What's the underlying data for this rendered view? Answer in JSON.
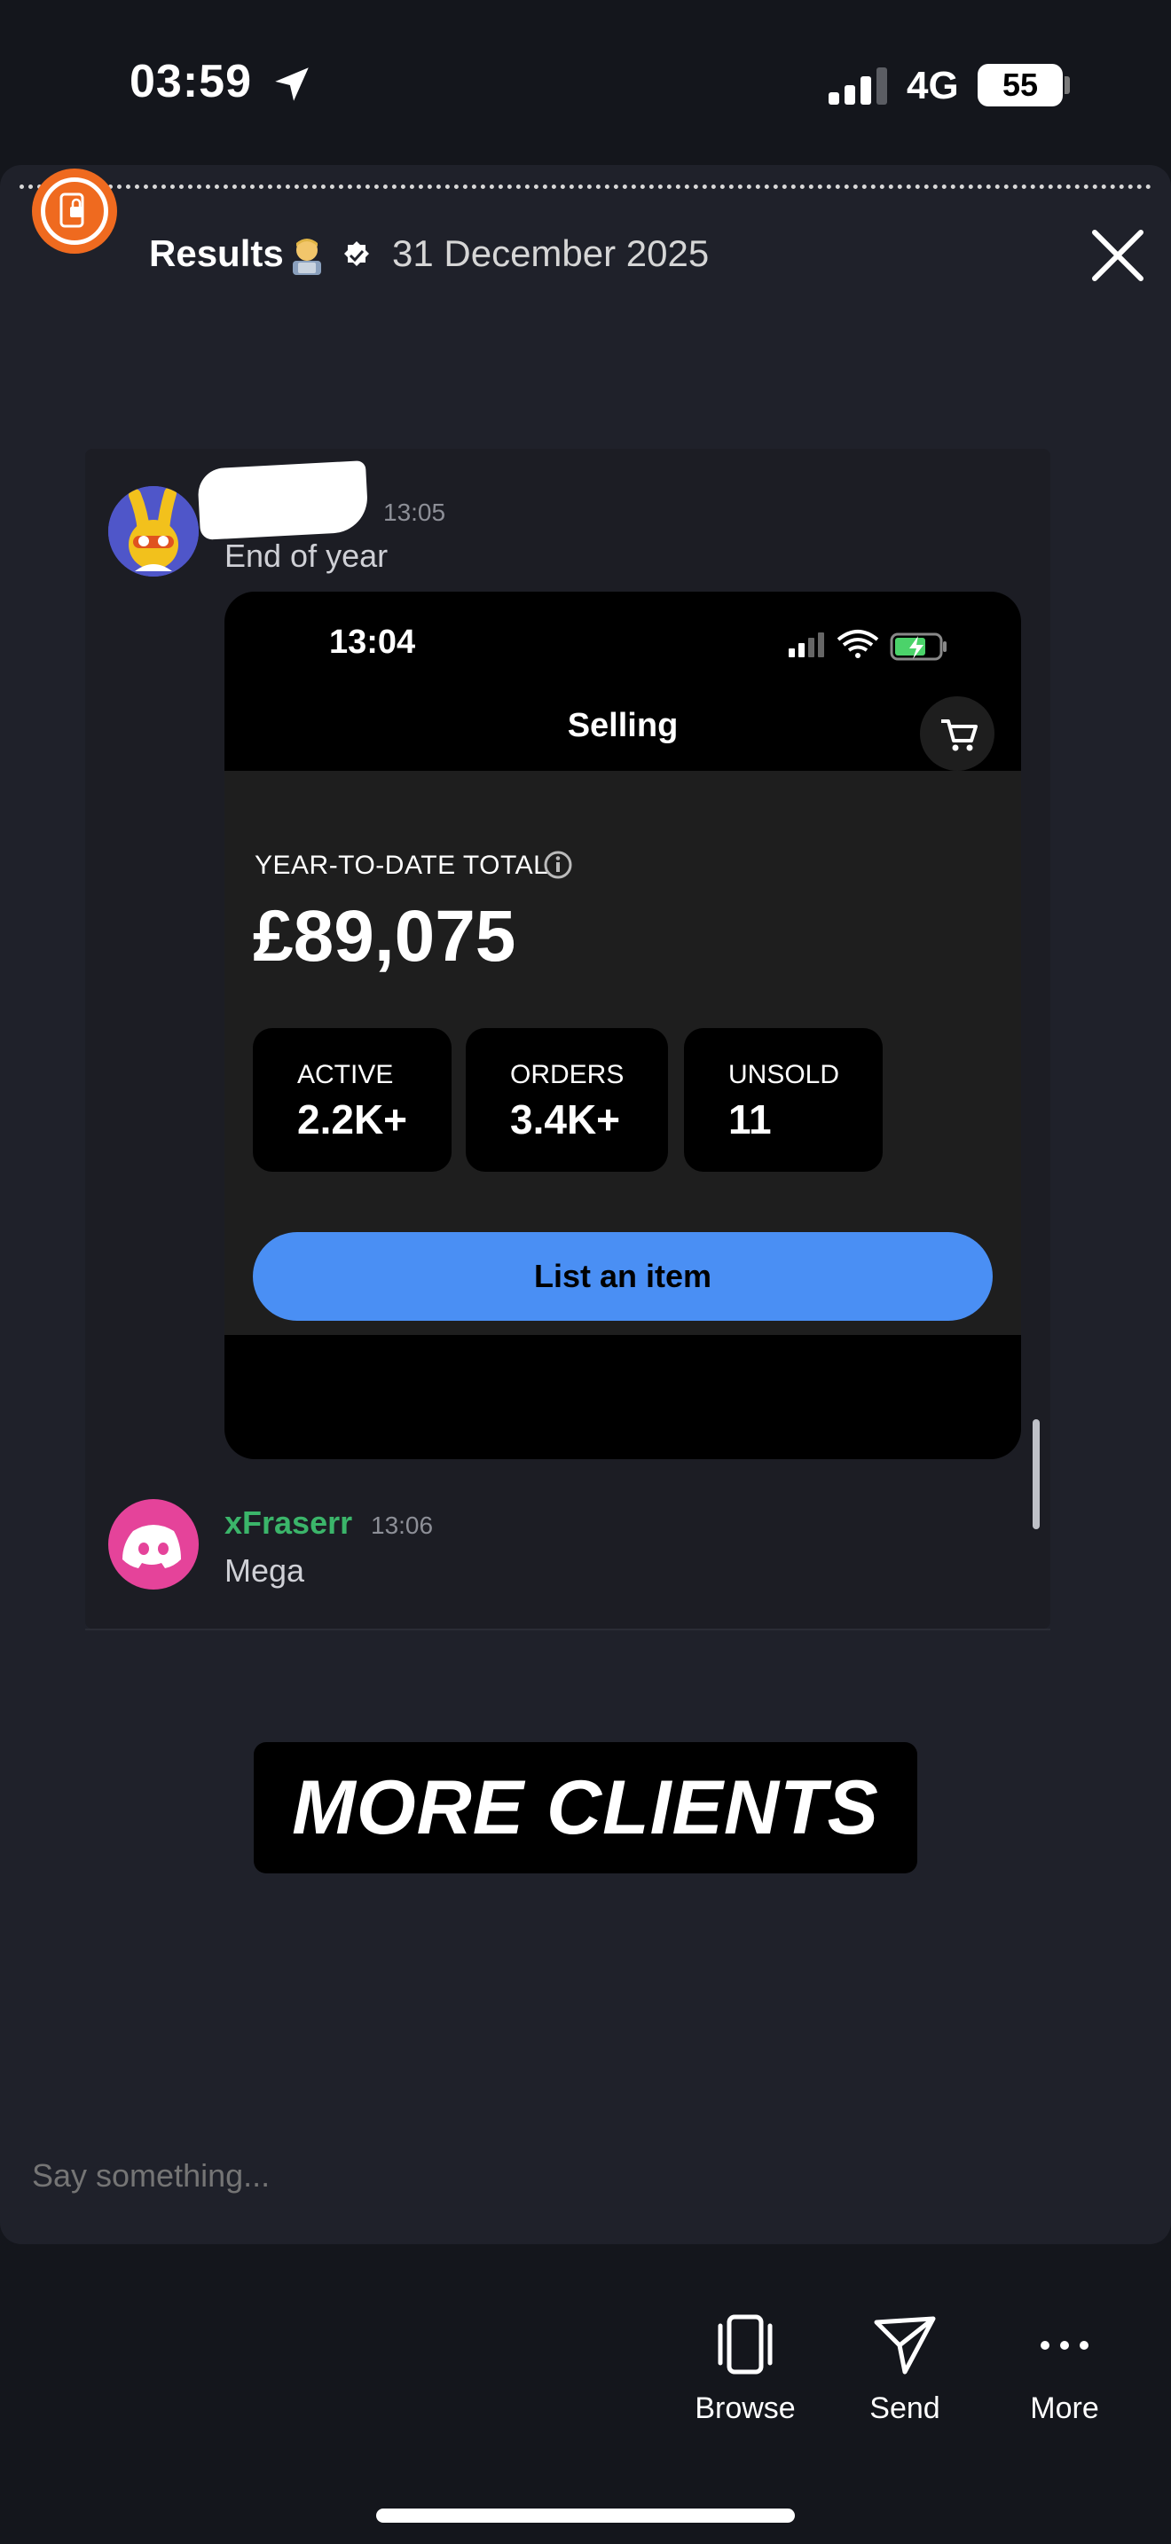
{
  "status_bar": {
    "time": "03:59",
    "network": "4G",
    "battery": "55"
  },
  "story": {
    "title": "Results",
    "date": "31 December 2025"
  },
  "messages": [
    {
      "time": "13:05",
      "text": "End of year"
    },
    {
      "author": "xFraserr",
      "time": "13:06",
      "text": "Mega"
    }
  ],
  "embedded_screenshot": {
    "time": "13:04",
    "title": "Selling",
    "ytd_label": "YEAR-TO-DATE TOTAL",
    "ytd_value": "£89,075",
    "stats": [
      {
        "label": "ACTIVE",
        "value": "2.2K+"
      },
      {
        "label": "ORDERS",
        "value": "3.4K+"
      },
      {
        "label": "UNSOLD",
        "value": "11"
      }
    ],
    "button": "List an item"
  },
  "sticker": "MORE CLIENTS",
  "reply": {
    "placeholder": "Say something..."
  },
  "actions": [
    {
      "label": "Browse",
      "icon": "browse-icon"
    },
    {
      "label": "Send",
      "icon": "send-icon"
    },
    {
      "label": "More",
      "icon": "more-icon"
    }
  ],
  "colors": {
    "accent_blue": "#4a8ff4",
    "author_green": "#3bb56a",
    "avatar_orange": "#ef6a1f",
    "discord_pink": "#e5439a"
  }
}
